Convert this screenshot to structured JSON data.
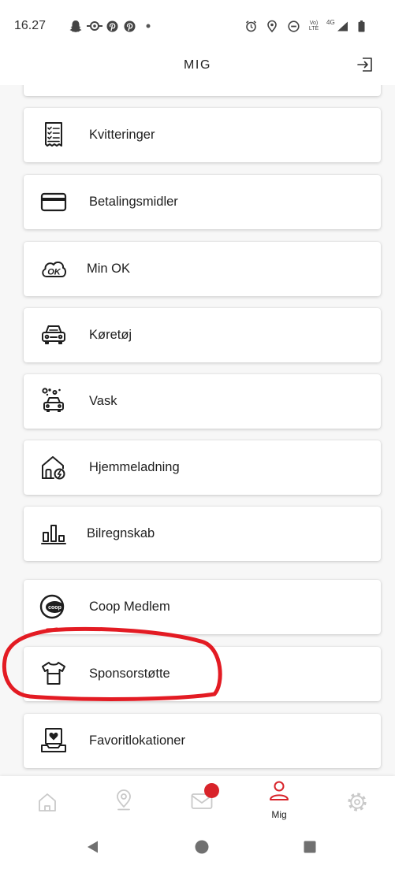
{
  "status_bar": {
    "time": "16.27",
    "volte_top": "Vo)",
    "volte_bottom": "LTE",
    "network": "4G",
    "left_icons": [
      "snapchat-icon",
      "eye-icon",
      "pinterest-icon",
      "pinterest-icon",
      "notification-dot-icon"
    ],
    "right_icons": [
      "alarm-icon",
      "location-icon",
      "do-not-disturb-icon",
      "volte-icon",
      "signal-icon",
      "battery-icon"
    ]
  },
  "header": {
    "title": "MIG",
    "action_icon": "logout-icon"
  },
  "menu": {
    "items": [
      {
        "label": "Kvitteringer",
        "icon": "receipt-icon"
      },
      {
        "label": "Betalingsmidler",
        "icon": "credit-card-icon"
      },
      {
        "label": "Min OK",
        "icon": "min-ok-logo-icon",
        "logo_text": "OK"
      },
      {
        "label": "Køretøj",
        "icon": "car-icon"
      },
      {
        "label": "Vask",
        "icon": "car-wash-icon"
      },
      {
        "label": "Hjemmeladning",
        "icon": "home-charging-icon"
      },
      {
        "label": "Bilregnskab",
        "icon": "bar-chart-icon"
      },
      {
        "label": "Coop Medlem",
        "icon": "coop-logo-icon",
        "logo_text": "coop"
      },
      {
        "label": "Sponsorstøtte",
        "icon": "t-shirt-icon",
        "circled": true
      },
      {
        "label": "Favoritlokationer",
        "icon": "favorite-location-icon"
      }
    ]
  },
  "bottom_nav": {
    "items": [
      {
        "icon": "home-icon"
      },
      {
        "icon": "location-pin-icon"
      },
      {
        "icon": "mail-icon",
        "badge": true
      },
      {
        "icon": "profile-icon",
        "label": "Mig",
        "active": true
      },
      {
        "icon": "settings-icon"
      }
    ]
  },
  "system_nav": {
    "icons": [
      "back-icon",
      "home-circle-icon",
      "recents-square-icon"
    ]
  },
  "colors": {
    "accent": "#d8232a",
    "annotation": "#e31b23",
    "icon_inactive": "#c9c9c9",
    "text": "#1e1e1e",
    "background": "#f7f7f7"
  }
}
